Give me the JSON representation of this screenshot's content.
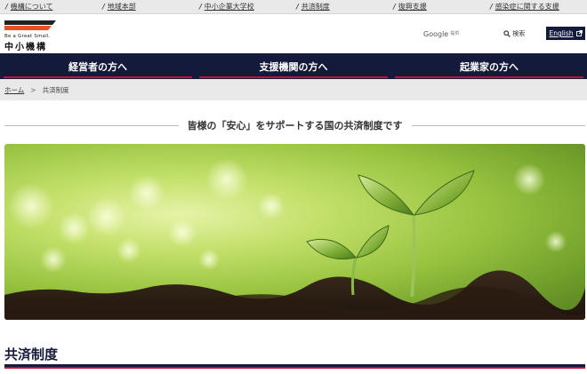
{
  "topbar": {
    "links": [
      "機構について",
      "地域本部",
      "中小企業大学校",
      "共済制度",
      "復興支援",
      "感染症に関する支援"
    ]
  },
  "header": {
    "logo_tagline": "Be a Great Small.",
    "logo_name": "中小機構",
    "search_brand": "Google",
    "search_placeholder": "提供",
    "search_button": "検索",
    "english_label": "English"
  },
  "nav": {
    "items": [
      "経営者の方へ",
      "支援機関の方へ",
      "起業家の方へ"
    ]
  },
  "breadcrumb": {
    "home": "ホーム",
    "separator": ">",
    "current": "共済制度"
  },
  "lead": {
    "text": "皆様の「安心」をサポートする国の共済制度です"
  },
  "main": {
    "page_title": "共済制度"
  },
  "colors": {
    "navy": "#141a3c",
    "accent_red": "#c8102e",
    "topbar_bg": "#e9e9e9"
  },
  "icons": {
    "search": "search-icon",
    "external": "external-link-icon",
    "logo": "logo-bars-icon"
  }
}
